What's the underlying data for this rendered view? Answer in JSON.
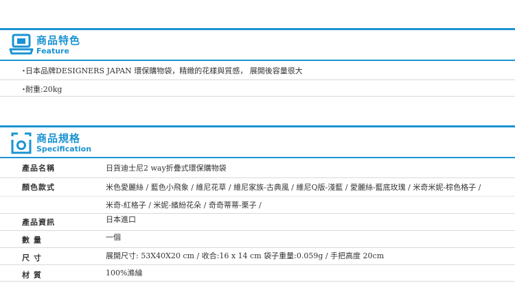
{
  "feature": {
    "title_zh": "商品特色",
    "title_en": "Feature",
    "bullet": "・",
    "items": [
      "日本品牌DESIGNERS JAPAN 環保購物袋，精緻的花樣與質感， 展開後容量很大",
      "耐重:20kg"
    ]
  },
  "spec": {
    "title_zh": "商品規格",
    "title_en": "Specification",
    "rows": [
      {
        "label": "產品名稱",
        "lines": [
          "日貨迪士尼2 way折疊式環保購物袋"
        ]
      },
      {
        "label": "顏色款式",
        "lines": [
          "米色愛麗絲 / 藍色小飛象 / 維尼花草 / 維尼家族-古典風 / 維尼Q版-淺藍 / 愛麗絲-藍底玫瑰 / 米奇米妮-棕色格子 /",
          "米奇-紅格子 / 米妮-繽紛花朵 / 奇奇蒂蒂-栗子 /"
        ]
      },
      {
        "label": "產品資訊",
        "lines": [
          "日本進口"
        ]
      },
      {
        "label": "數 量",
        "lines": [
          "一個"
        ]
      },
      {
        "label": "尺 寸",
        "lines": [
          "展開尺寸: 53X40X20 cm / 收合:16 x 14 cm 袋子重量:0.059g / 手把高度 20cm"
        ]
      },
      {
        "label": "材 質",
        "lines": [
          "100%滌綸"
        ]
      }
    ]
  },
  "colors": {
    "accent": "#1a93d2",
    "divider": "#d9d9d9"
  }
}
